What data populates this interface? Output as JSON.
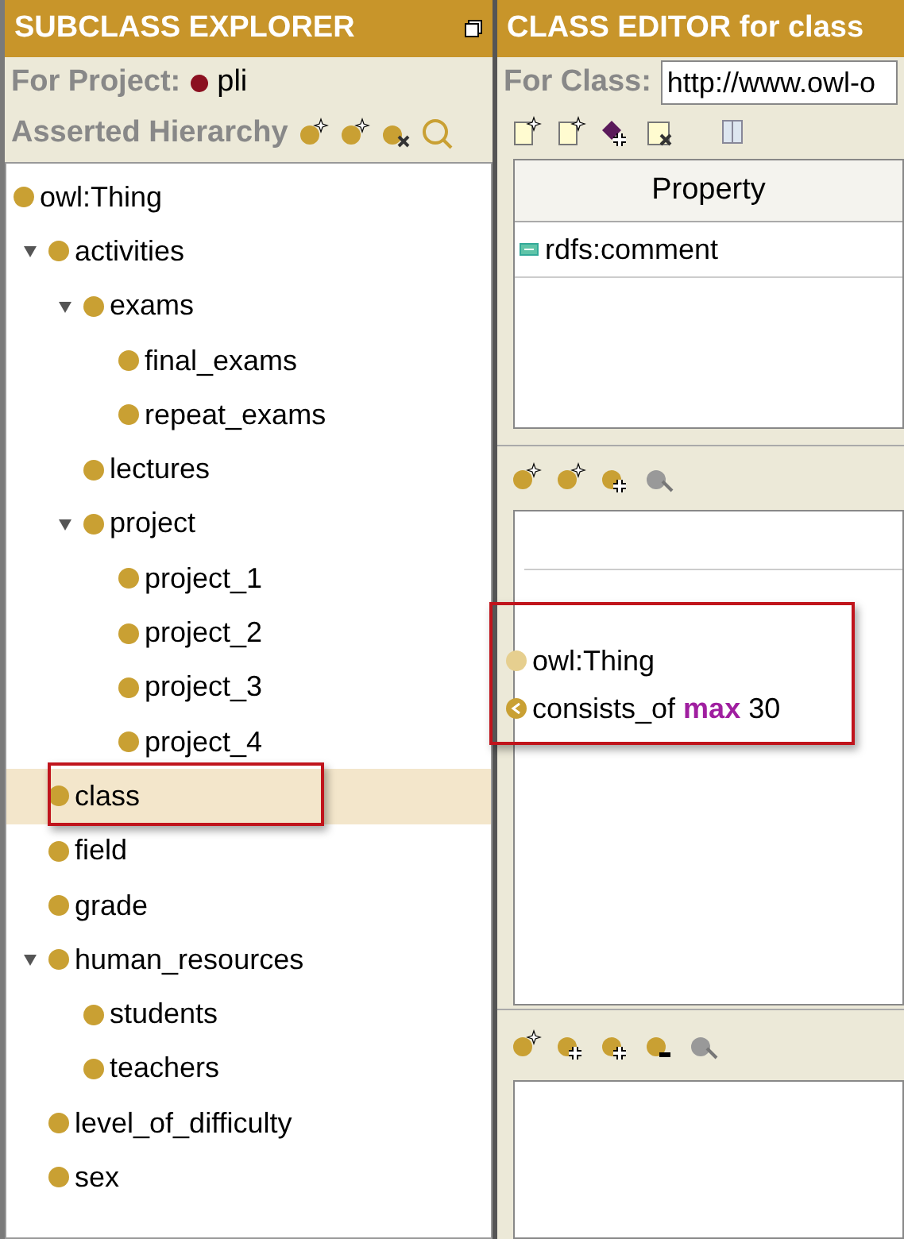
{
  "explorer": {
    "title": "SUBCLASS EXPLORER",
    "project_label": "For Project:",
    "project_name": "pli",
    "hierarchy_label": "Asserted Hierarchy",
    "tree": [
      {
        "label": "owl:Thing",
        "selected": false,
        "children": [
          {
            "label": "activities",
            "expanded": true,
            "selected": false,
            "children": [
              {
                "label": "exams",
                "expanded": true,
                "selected": false,
                "children": [
                  {
                    "label": "final_exams",
                    "selected": false
                  },
                  {
                    "label": "repeat_exams",
                    "selected": false
                  }
                ]
              },
              {
                "label": "lectures",
                "selected": false
              },
              {
                "label": "project",
                "expanded": true,
                "selected": false,
                "children": [
                  {
                    "label": "project_1",
                    "selected": false
                  },
                  {
                    "label": "project_2",
                    "selected": false
                  },
                  {
                    "label": "project_3",
                    "selected": false
                  },
                  {
                    "label": "project_4",
                    "selected": false
                  }
                ]
              }
            ]
          },
          {
            "label": "class",
            "selected": true,
            "annotated": true
          },
          {
            "label": "field",
            "selected": false
          },
          {
            "label": "grade",
            "selected": false
          },
          {
            "label": "human_resources",
            "expanded": true,
            "selected": false,
            "children": [
              {
                "label": "students",
                "selected": false
              },
              {
                "label": "teachers",
                "selected": false
              }
            ]
          },
          {
            "label": "level_of_difficulty",
            "selected": false
          },
          {
            "label": "sex",
            "selected": false
          }
        ]
      }
    ]
  },
  "editor": {
    "title": "CLASS EDITOR for class",
    "class_label": "For Class:",
    "class_value": "http://www.owl-o",
    "table": {
      "columns": [
        "Property"
      ],
      "rows": [
        "rdfs:comment"
      ]
    },
    "superclasses": {
      "annotated": true,
      "items": [
        {
          "kind": "class",
          "text": "owl:Thing"
        },
        {
          "kind": "restriction",
          "text": "consists_of **max** 30"
        }
      ]
    }
  }
}
